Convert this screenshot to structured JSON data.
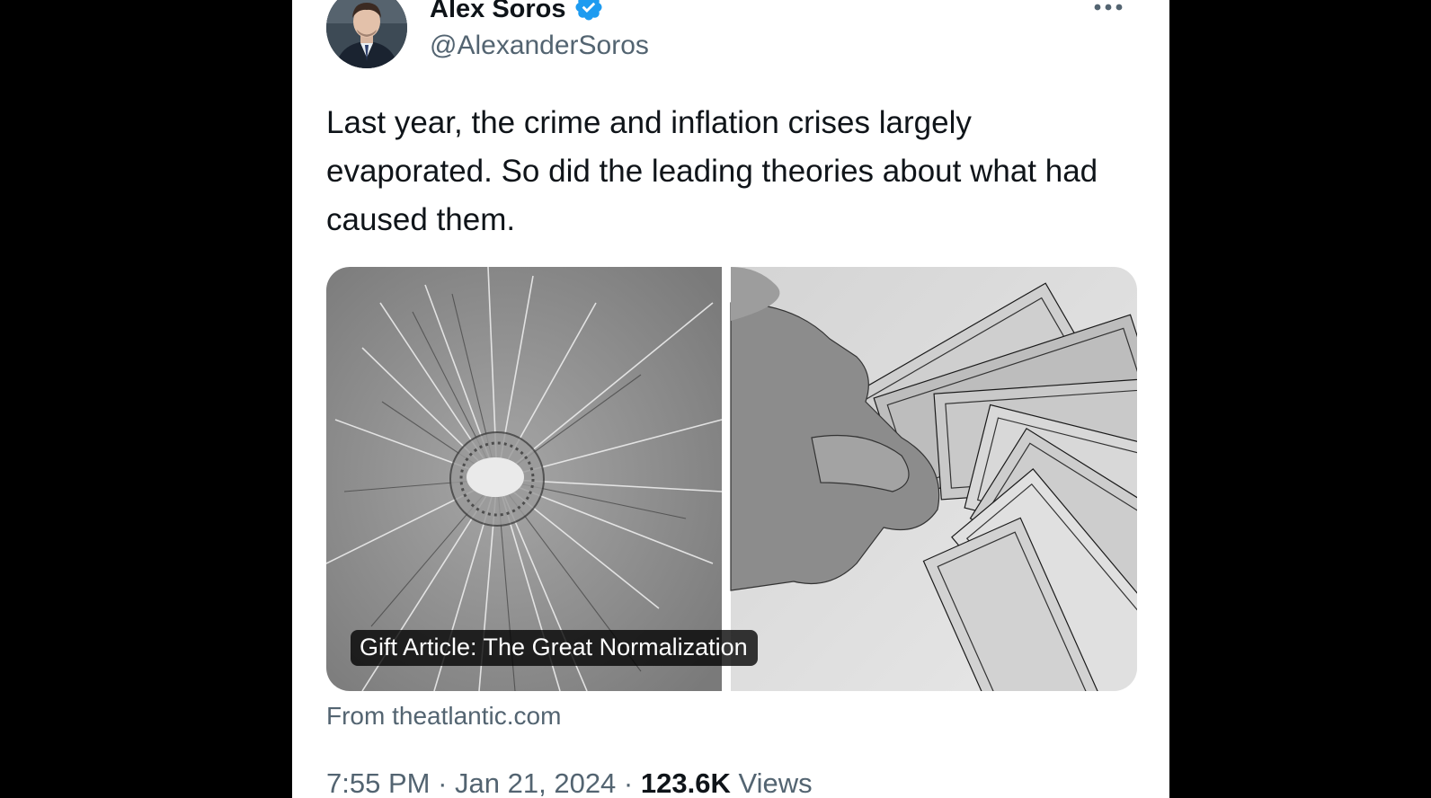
{
  "tweet": {
    "author_name": "Alex Soros",
    "handle": "@AlexanderSoros",
    "verified": true,
    "verified_color": "#1d9bf0",
    "text": "Last year, the crime and inflation crises largely evaporated. So did the leading theories about what had caused them.",
    "media": {
      "left_image": "shattered-glass-bullet-hole",
      "right_image": "hand-holding-dollar-bills",
      "article_label": "Gift Article: The Great Normalization"
    },
    "source": "From theatlantic.com",
    "time": "7:55 PM",
    "separator": "·",
    "date": "Jan 21, 2024",
    "views_count": "123.6K",
    "views_label": "Views"
  },
  "icons": {
    "more": "more-horizontal-icon",
    "verified": "verified-badge-icon"
  }
}
